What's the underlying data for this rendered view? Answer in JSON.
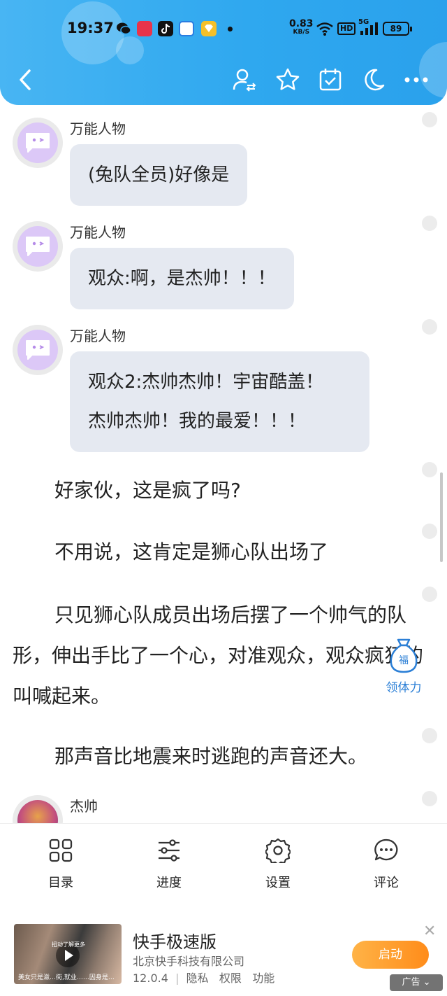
{
  "status_bar": {
    "time": "19:37",
    "net_speed": "0.83",
    "net_unit": "KB/S",
    "hd": "HD",
    "signal": "5G",
    "battery": "89"
  },
  "header": {
    "back_icon": "chevron-left-icon",
    "actions": [
      "user-switch-icon",
      "star-icon",
      "calendar-check-icon",
      "moon-icon",
      "more-icon"
    ]
  },
  "messages": [
    {
      "sender": "万能人物",
      "lines": [
        "(兔队全员)好像是"
      ]
    },
    {
      "sender": "万能人物",
      "lines": [
        "观众:啊，是杰帅！！！"
      ]
    },
    {
      "sender": "万能人物",
      "lines": [
        "观众2:杰帅杰帅！宇宙酷盖！",
        "杰帅杰帅！我的最爱！！！"
      ]
    }
  ],
  "paragraphs": [
    "好家伙，这是疯了吗?",
    "不用说，这肯定是狮心队出场了",
    "只见狮心队成员出场后摆了一个帅气的队形，伸出手比了一个心，对准观众，观众疯狂的叫喊起来。",
    "那声音比地震来时逃跑的声音还大。"
  ],
  "last_sender": "杰帅",
  "reward": {
    "label": "领体力",
    "icon": "bag-icon",
    "badge": "福"
  },
  "toolbar": [
    {
      "label": "目录",
      "icon": "grid-icon"
    },
    {
      "label": "进度",
      "icon": "sliders-icon"
    },
    {
      "label": "设置",
      "icon": "gear-icon"
    },
    {
      "label": "评论",
      "icon": "comment-icon"
    }
  ],
  "ad": {
    "title": "快手极速版",
    "company": "北京快手科技有限公司",
    "version": "12.0.4",
    "links": [
      "隐私",
      "权限",
      "功能"
    ],
    "button": "启动",
    "tag": "广告",
    "thumb_caption": "美女只是滋…街,就业……因身是…",
    "thumb_overlay": "扭动了解更多"
  }
}
